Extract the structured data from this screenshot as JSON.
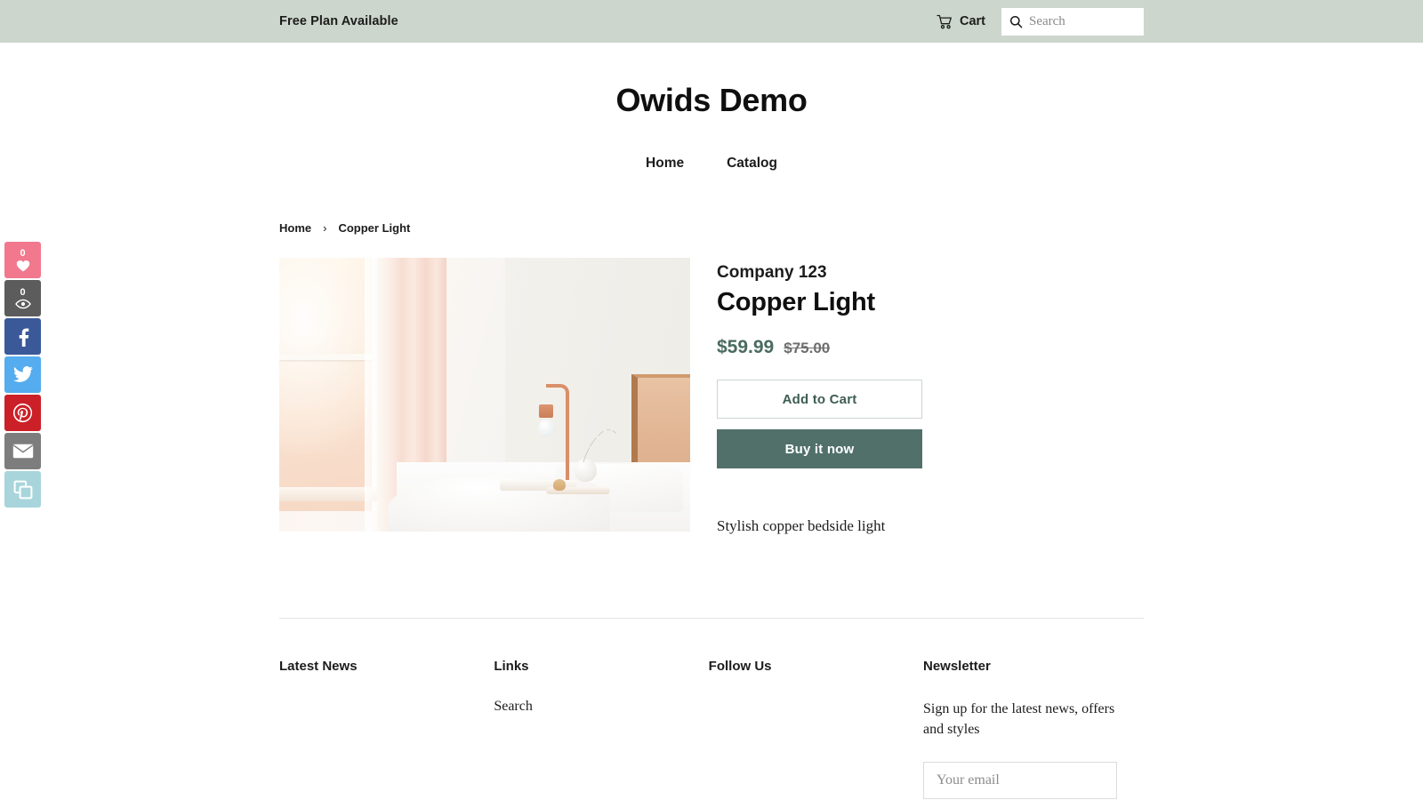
{
  "top_bar": {
    "announcement": "Free Plan Available",
    "cart_label": "Cart",
    "cart_icon": "shopping-cart-icon",
    "search_icon": "search-icon",
    "search_placeholder": "Search",
    "search_value": "",
    "background_color": "#ccd6cc"
  },
  "header": {
    "store_title": "Owids Demo",
    "nav": [
      {
        "label": "Home"
      },
      {
        "label": "Catalog"
      }
    ]
  },
  "breadcrumb": {
    "items": [
      {
        "label": "Home"
      },
      {
        "label": "Copper Light"
      }
    ],
    "separator": "›"
  },
  "product": {
    "image_alt": "Copper bedside lamp on a nightstand beside a bed in a sunlit bedroom",
    "vendor": "Company 123",
    "title": "Copper Light",
    "price": "$59.99",
    "compare_at_price": "$75.00",
    "price_color": "#4a6b5f",
    "add_to_cart_label": "Add to Cart",
    "buy_now_label": "Buy it now",
    "buy_now_color": "#51706a",
    "description": "Stylish copper bedside light"
  },
  "share_rail": {
    "tiles": [
      {
        "name": "like",
        "icon": "heart-icon",
        "count": "0",
        "color": "#f1788d"
      },
      {
        "name": "views",
        "icon": "eye-icon",
        "count": "0",
        "color": "#5c5c5c"
      },
      {
        "name": "facebook",
        "icon": "facebook-icon",
        "color": "#3b5998"
      },
      {
        "name": "twitter",
        "icon": "twitter-icon",
        "color": "#55acee"
      },
      {
        "name": "pinterest",
        "icon": "pinterest-icon",
        "color": "#cb2027"
      },
      {
        "name": "email",
        "icon": "envelope-icon",
        "color": "#7d7d7d"
      },
      {
        "name": "copy-link",
        "icon": "copy-icon",
        "color": "#a8d5dc"
      }
    ]
  },
  "footer": {
    "columns": [
      {
        "heading": "Latest News",
        "links": []
      },
      {
        "heading": "Links",
        "links": [
          {
            "label": "Search"
          }
        ]
      },
      {
        "heading": "Follow Us",
        "links": []
      }
    ],
    "newsletter": {
      "heading": "Newsletter",
      "text": "Sign up for the latest news, offers and styles",
      "email_placeholder": "Your email",
      "email_value": ""
    }
  }
}
